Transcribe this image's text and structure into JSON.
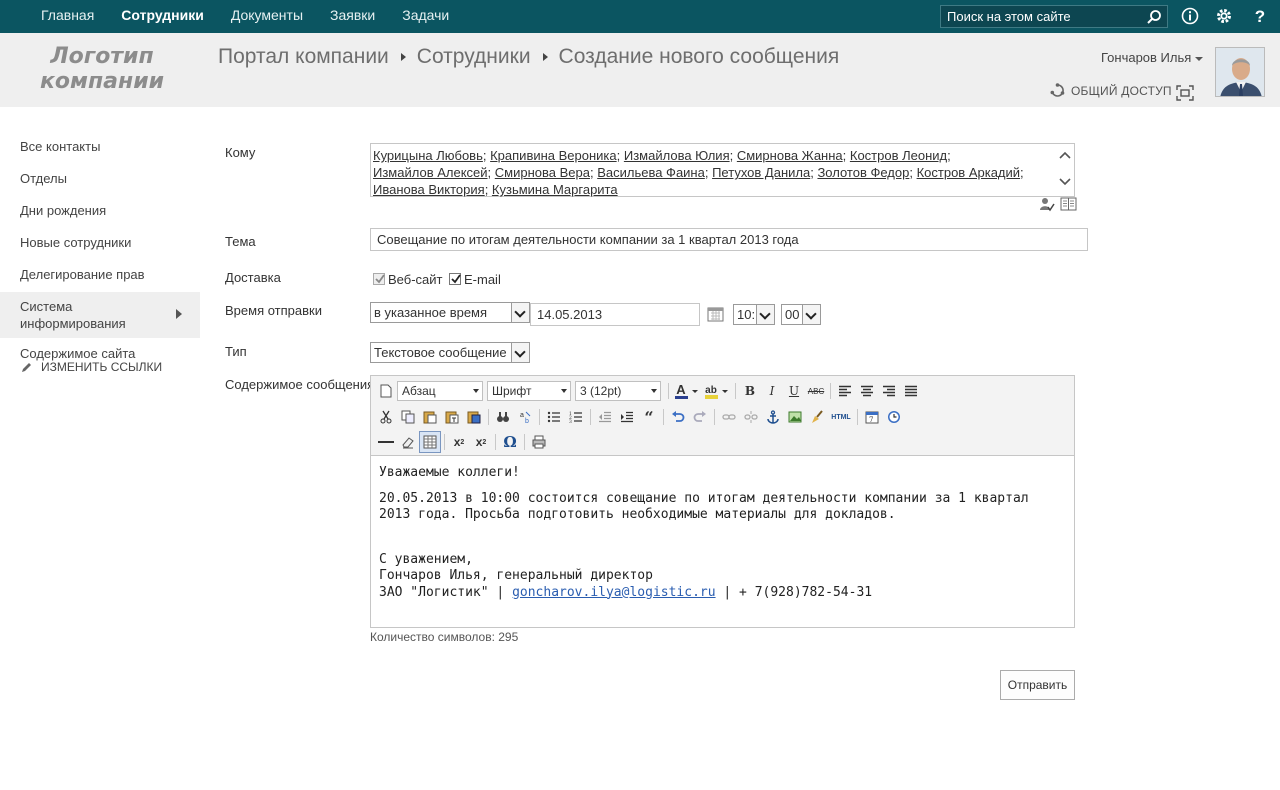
{
  "top_nav": {
    "items": [
      {
        "label": "Главная",
        "active": false
      },
      {
        "label": "Сотрудники",
        "active": true
      },
      {
        "label": "Документы",
        "active": false
      },
      {
        "label": "Заявки",
        "active": false
      },
      {
        "label": "Задачи",
        "active": false
      }
    ],
    "search_placeholder": "Поиск на этом сайте"
  },
  "header": {
    "logo_line1": "Логотип",
    "logo_line2": "компании",
    "breadcrumb": [
      "Портал компании",
      "Сотрудники",
      "Создание нового сообщения"
    ],
    "username": "Гончаров Илья",
    "share_label": "ОБЩИЙ ДОСТУП"
  },
  "left_nav": {
    "items": [
      {
        "label": "Все контакты"
      },
      {
        "label": "Отделы"
      },
      {
        "label": "Дни рождения"
      },
      {
        "label": "Новые сотрудники"
      },
      {
        "label": "Делегирование прав"
      },
      {
        "label": "Система информирования",
        "selected": true
      },
      {
        "label": "Содержимое сайта"
      }
    ],
    "edit_links": "ИЗМЕНИТЬ ССЫЛКИ"
  },
  "form": {
    "to_label": "Кому",
    "recipients": [
      "Курицына Любовь",
      "Крапивина Вероника",
      "Измайлова Юлия",
      "Смирнова Жанна",
      "Костров Леонид",
      "Измайлов Алексей",
      "Смирнова Вера",
      "Васильева Фаина",
      "Петухов Данила",
      "Золотов Федор",
      "Костров Аркадий",
      "Иванова Виктория",
      "Кузьмина Маргарита"
    ],
    "subject_label": "Тема",
    "subject_value": "Совещание по итогам деятельности компании за 1 квартал 2013 года",
    "delivery_label": "Доставка",
    "delivery_web": "Веб-сайт",
    "delivery_email": "E-mail",
    "send_time_label": "Время отправки",
    "send_mode": "в указанное время",
    "send_date": "14.05.2013",
    "send_hour": "10:",
    "send_minute": "00",
    "type_label": "Тип",
    "type_value": "Текстовое сообщение",
    "content_label": "Содержимое сообщения"
  },
  "editor": {
    "style_dd": "Абзац",
    "font_dd": "Шрифт",
    "size_dd": "3 (12pt)",
    "greeting": "Уважаемые коллеги!",
    "body": "20.05.2013 в 10:00 состоится совещание по итогам деятельности компании за 1 квартал 2013 года. Просьба подготовить необходимые материалы для докладов.",
    "closing": "С уважением,",
    "signature_name": "Гончаров Илья, генеральный директор",
    "company": "ЗАО \"Логистик\" |",
    "email": "goncharov.ilya@logistic.ru",
    "phone": "| + 7(928)782-54-31"
  },
  "char_count": "Количество символов: 295",
  "send_button": "Отправить"
}
